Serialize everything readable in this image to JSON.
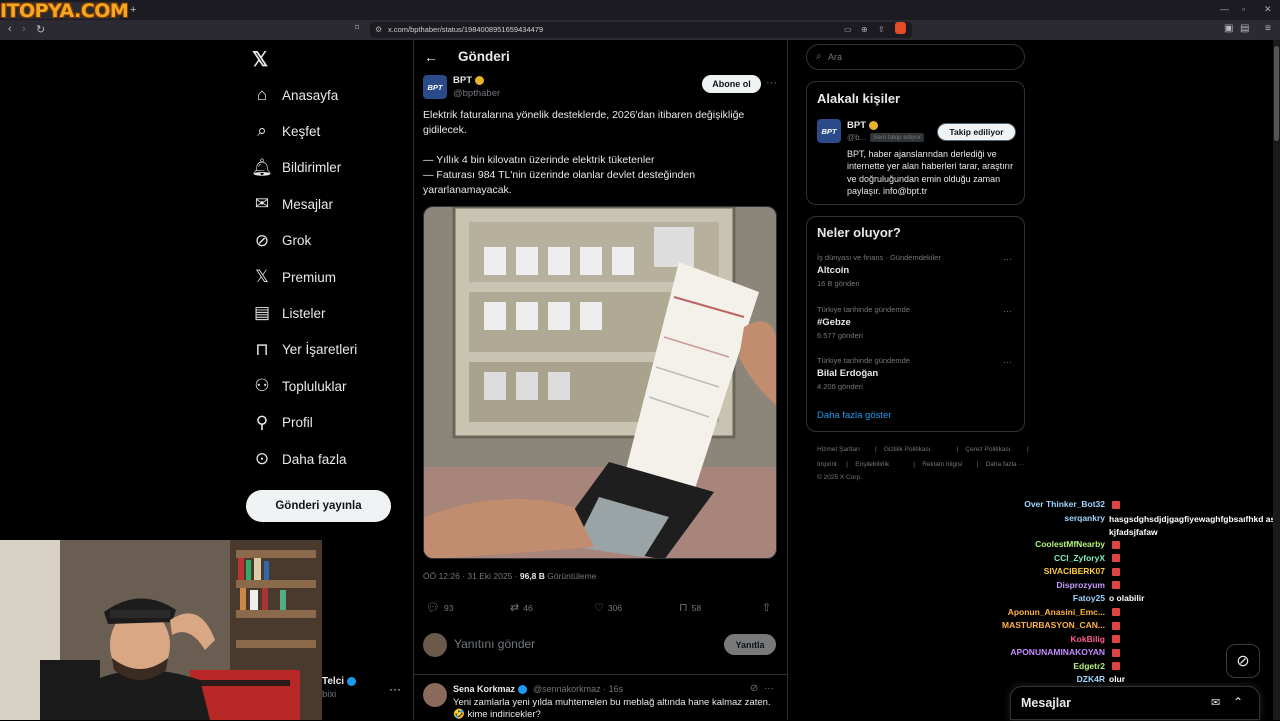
{
  "browser": {
    "site_logo": "ITOPYA.COM",
    "url": "x.com/bpthaber/status/1984008951659434479",
    "tab_close": "×",
    "tab_new": "+"
  },
  "nav": {
    "items": [
      {
        "label": "Anasayfa",
        "icon": "home-icon"
      },
      {
        "label": "Keşfet",
        "icon": "search-icon"
      },
      {
        "label": "Bildirimler",
        "icon": "bell-icon"
      },
      {
        "label": "Mesajlar",
        "icon": "mail-icon"
      },
      {
        "label": "Grok",
        "icon": "grok-icon"
      },
      {
        "label": "Premium",
        "icon": "x-icon"
      },
      {
        "label": "Listeler",
        "icon": "list-icon"
      },
      {
        "label": "Yer İşaretleri",
        "icon": "bookmark-icon"
      },
      {
        "label": "Topluluklar",
        "icon": "communities-icon"
      },
      {
        "label": "Profil",
        "icon": "profile-icon"
      },
      {
        "label": "Daha fazla",
        "icon": "more-icon"
      }
    ],
    "post_button": "Gönderi yayınla"
  },
  "account": {
    "name": "Telci",
    "handle": "bixi"
  },
  "post": {
    "header_title": "Gönderi",
    "author_name": "BPT",
    "author_handle": "@bpthaber",
    "avatar_text": "BPT",
    "subscribe": "Abone ol",
    "text_line1": "Elektrik faturalarına yönelik desteklerde, 2026'dan itibaren değişikliğe gidilecek.",
    "text_line2": "— Yıllık 4 bin kilovatın üzerinde elektrik tüketenler",
    "text_line3": "— Faturası 984 TL'nin üzerinde olanlar devlet desteğinden yararlanamayacak.",
    "time": "ÖÖ 12:26 · 31 Eki 2025 · ",
    "views": "96,8 B",
    "views_label": " Görüntüleme",
    "replies": "93",
    "reposts": "46",
    "likes": "306",
    "bookmarks": "58",
    "reply_placeholder": "Yanıtını gönder",
    "reply_button": "Yanıtla"
  },
  "comment": {
    "name": "Sena Korkmaz",
    "handle": "@sennakorkmaz · 16s",
    "text": "Yeni zamlarla yeni yılda muhtemelen bu meblağ altında hane kalmaz zaten. 🤣 kime indiricekler?"
  },
  "sidebar": {
    "search_placeholder": "Ara",
    "related_title": "Alakalı kişiler",
    "related_name": "BPT",
    "related_handle": "@b...",
    "related_follows": "Seni takip ediyor",
    "related_button": "Takip ediliyor",
    "related_bio": "BPT, haber ajanslarından derlediği ve internette yer alan haberleri tarar, araştırır ve doğruluğundan emin olduğu zaman paylaşır. info@bpt.tr",
    "trends_title": "Neler oluyor?",
    "trends": [
      {
        "category": "İş dünyası ve finans · Gündemdekiler",
        "name": "Altcoin",
        "count": "16 B gönderi"
      },
      {
        "category": "Türkiye tarihinde gündemde",
        "name": "#Gebze",
        "count": "6.577 gönderi"
      },
      {
        "category": "Türkiye tarihinde gündemde",
        "name": "Bilal Erdoğan",
        "count": "4.206 gönderi"
      }
    ],
    "show_more": "Daha fazla göster",
    "footer_row1": [
      "Hizmet Şartları",
      "|",
      "Gizlilik Politikası",
      "|",
      "Çerez Politikası",
      "|"
    ],
    "footer_row2": [
      "Imprint",
      "|",
      "Erişilebilirlik",
      "|",
      "Reklam bilgisi",
      "|",
      "Daha fazla ···"
    ],
    "copyright": "© 2025 X Corp."
  },
  "chat": [
    {
      "user": "Over Thinker_Bot32",
      "msg": "",
      "color": "#9fd6ff"
    },
    {
      "user": "serqankry",
      "msg": "hasgsdghsdjdjgagfiyewaghfgbsaıfhkd askjfadsjfafaw",
      "color": "#9fd6ff"
    },
    {
      "user": "CoolestMfNearby",
      "msg": "",
      "color": "#b7f27c"
    },
    {
      "user": "CCI_ZyforyX",
      "msg": "",
      "color": "#7ff0c0"
    },
    {
      "user": "SIVACIBERK07",
      "msg": "",
      "color": "#ffcc44"
    },
    {
      "user": "Disprozyum",
      "msg": "",
      "color": "#c69bff"
    },
    {
      "user": "Fatoy25",
      "msg": "o olabilir",
      "color": "#9fd6ff"
    },
    {
      "user": "Aponun_Anasini_Emc...",
      "msg": "",
      "color": "#ffb347"
    },
    {
      "user": "MASTURBASYON_CAN...",
      "msg": "",
      "color": "#ffb347"
    },
    {
      "user": "KokBilig",
      "msg": "",
      "color": "#ff5d8f"
    },
    {
      "user": "APONUNAMINAKOYAN",
      "msg": "",
      "color": "#c58bff"
    },
    {
      "user": "Edgetr2",
      "msg": "",
      "color": "#b7f27c"
    },
    {
      "user": "DZK4R",
      "msg": "olur",
      "color": "#9fd6ff"
    },
    {
      "user": "Gravitas0",
      "msg": "",
      "color": "#7fc8ff"
    },
    {
      "user": "trapyalcin",
      "msg": "",
      "color": "#ffcc44"
    }
  ],
  "drawer": {
    "title": "Mesajlar"
  }
}
